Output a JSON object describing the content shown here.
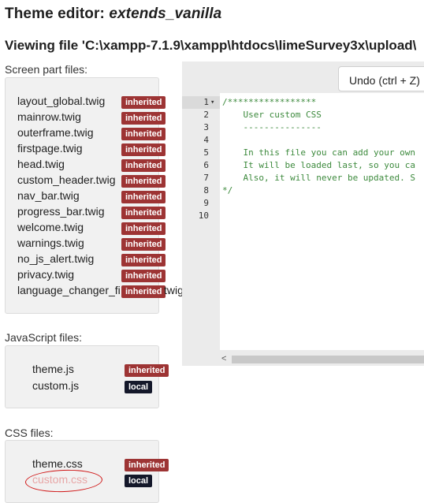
{
  "header": {
    "title_prefix": "Theme editor: ",
    "theme_name": "extends_vanilla",
    "viewing_file": "Viewing file 'C:\\xampp-7.1.9\\xampp\\htdocs\\limeSurvey3x\\upload\\"
  },
  "screen_part": {
    "label": "Screen part files:",
    "files": [
      {
        "name": "layout_global.twig",
        "badge": "inherited"
      },
      {
        "name": "mainrow.twig",
        "badge": "inherited"
      },
      {
        "name": "outerframe.twig",
        "badge": "inherited"
      },
      {
        "name": "firstpage.twig",
        "badge": "inherited"
      },
      {
        "name": "head.twig",
        "badge": "inherited"
      },
      {
        "name": "custom_header.twig",
        "badge": "inherited"
      },
      {
        "name": "nav_bar.twig",
        "badge": "inherited"
      },
      {
        "name": "progress_bar.twig",
        "badge": "inherited"
      },
      {
        "name": "welcome.twig",
        "badge": "inherited"
      },
      {
        "name": "warnings.twig",
        "badge": "inherited"
      },
      {
        "name": "no_js_alert.twig",
        "badge": "inherited"
      },
      {
        "name": "privacy.twig",
        "badge": "inherited"
      },
      {
        "name": "language_changer_fi",
        "name_tail": "twig",
        "badge": "inherited"
      }
    ]
  },
  "javascript": {
    "label": "JavaScript files:",
    "files": [
      {
        "name": "theme.js",
        "badge": "inherited"
      },
      {
        "name": "custom.js",
        "badge": "local"
      }
    ]
  },
  "css": {
    "label": "CSS files:",
    "files": [
      {
        "name": "theme.css",
        "badge": "inherited"
      },
      {
        "name": "custom.css",
        "badge": "local"
      }
    ]
  },
  "editor": {
    "undo_label": "Undo (ctrl + Z)",
    "line_numbers": [
      "1",
      "2",
      "3",
      "4",
      "5",
      "6",
      "7",
      "8",
      "9",
      "10"
    ],
    "fold_marker": "▾",
    "lines": [
      "/*****************",
      "    User custom CSS",
      "    ---------------",
      "",
      "    In this file you can add your own",
      "    It will be loaded last, so you ca",
      "    Also, it will never be updated. S",
      "*/",
      "",
      ""
    ],
    "scroll_left_arrow": "<"
  },
  "colors": {
    "inherited_badge": "#9d3434",
    "local_badge": "#14182a",
    "code_comment": "#3d8a3d",
    "highlight_link": "#e8a6a6",
    "annotation_circle": "#d01515"
  }
}
